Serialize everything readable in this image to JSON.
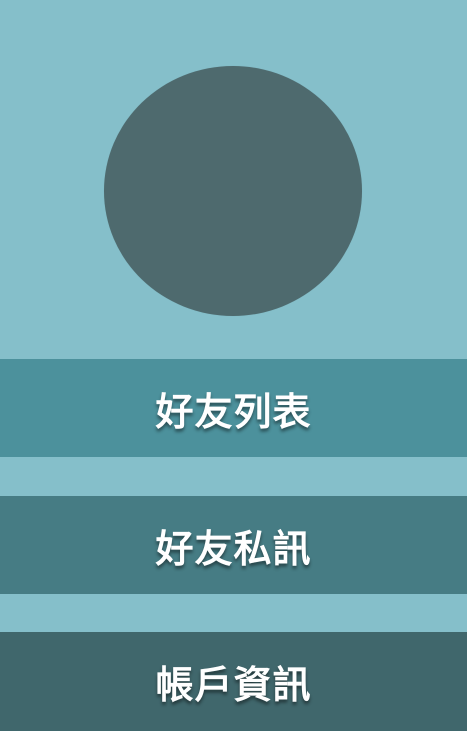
{
  "profile": {
    "avatar_color": "#4e6a6e"
  },
  "menu": {
    "items": [
      {
        "label": "好友列表",
        "color": "#4c919c"
      },
      {
        "label": "好友私訊",
        "color": "#467c84"
      },
      {
        "label": "帳戶資訊",
        "color": "#40676c"
      }
    ]
  },
  "theme": {
    "background": "#85bfca",
    "text_color": "#ffffff"
  }
}
